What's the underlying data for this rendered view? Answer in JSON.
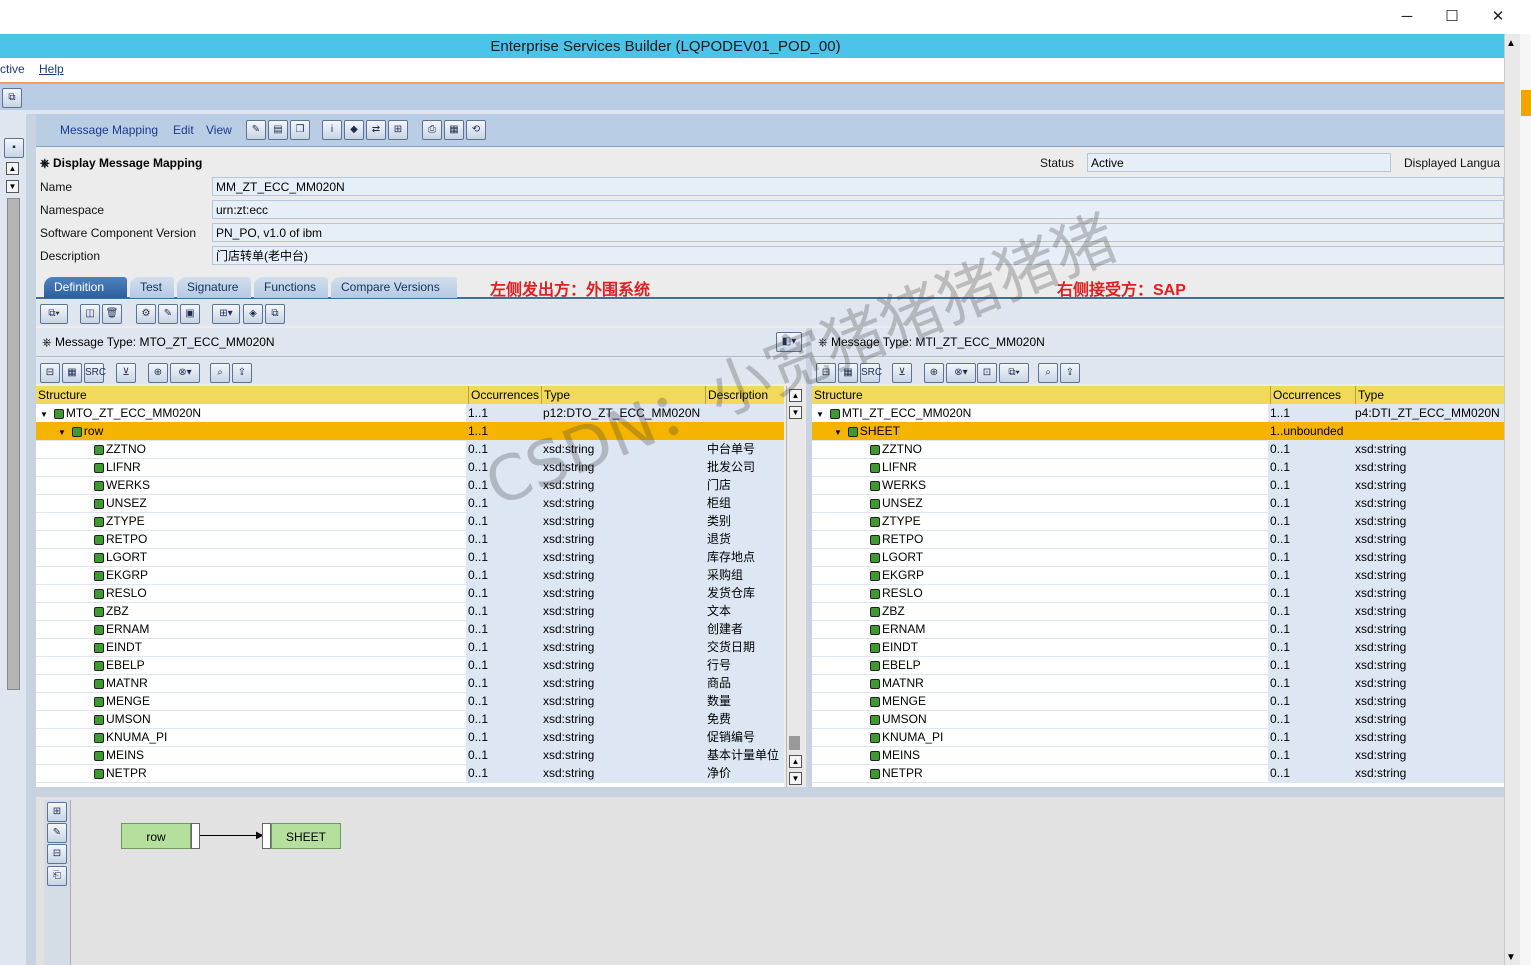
{
  "window": {
    "title": "Enterprise Services Builder (LQPODEV01_POD_00)",
    "minimize": "─",
    "maximize": "☐",
    "close": "✕"
  },
  "menubar": {
    "items": [
      "ctive",
      "Help"
    ]
  },
  "editor_menu": {
    "items": [
      "Message Mapping",
      "Edit",
      "View"
    ]
  },
  "form": {
    "heading": "Display Message Mapping",
    "status_label": "Status",
    "status_value": "Active",
    "displayed_lang_label": "Displayed Langua",
    "fields": [
      {
        "label": "Name",
        "value": "MM_ZT_ECC_MM020N"
      },
      {
        "label": "Namespace",
        "value": "urn:zt:ecc"
      },
      {
        "label": "Software Component Version",
        "value": "PN_PO, v1.0 of ibm"
      },
      {
        "label": "Description",
        "value": "门店转单(老中台)"
      }
    ]
  },
  "tabs": [
    "Definition",
    "Test",
    "Signature",
    "Functions",
    "Compare Versions"
  ],
  "annotations": {
    "left": "左侧发出方：外围系统",
    "right": "右侧接受方：SAP"
  },
  "watermark": "CSDN：小宽猪猪猪猪猪",
  "source": {
    "title": "Message Type: MTO_ZT_ECC_MM020N",
    "columns": [
      "Structure",
      "Occurrences",
      "Type",
      "Description"
    ],
    "root": {
      "name": "MTO_ZT_ECC_MM020N",
      "occ": "1..1",
      "type": "p12:DTO_ZT_ECC_MM020N",
      "desc": ""
    },
    "row": {
      "name": "row",
      "occ": "1..1",
      "type": "",
      "desc": ""
    },
    "fields": [
      {
        "name": "ZZTNO",
        "occ": "0..1",
        "type": "xsd:string",
        "desc": "中台单号"
      },
      {
        "name": "LIFNR",
        "occ": "0..1",
        "type": "xsd:string",
        "desc": "批发公司"
      },
      {
        "name": "WERKS",
        "occ": "0..1",
        "type": "xsd:string",
        "desc": "门店"
      },
      {
        "name": "UNSEZ",
        "occ": "0..1",
        "type": "xsd:string",
        "desc": "柜组"
      },
      {
        "name": "ZTYPE",
        "occ": "0..1",
        "type": "xsd:string",
        "desc": "类别"
      },
      {
        "name": "RETPO",
        "occ": "0..1",
        "type": "xsd:string",
        "desc": "退货"
      },
      {
        "name": "LGORT",
        "occ": "0..1",
        "type": "xsd:string",
        "desc": "库存地点"
      },
      {
        "name": "EKGRP",
        "occ": "0..1",
        "type": "xsd:string",
        "desc": "采购组"
      },
      {
        "name": "RESLO",
        "occ": "0..1",
        "type": "xsd:string",
        "desc": "发货仓库"
      },
      {
        "name": "ZBZ",
        "occ": "0..1",
        "type": "xsd:string",
        "desc": "文本"
      },
      {
        "name": "ERNAM",
        "occ": "0..1",
        "type": "xsd:string",
        "desc": "创建者"
      },
      {
        "name": "EINDT",
        "occ": "0..1",
        "type": "xsd:string",
        "desc": "交货日期"
      },
      {
        "name": "EBELP",
        "occ": "0..1",
        "type": "xsd:string",
        "desc": "行号"
      },
      {
        "name": "MATNR",
        "occ": "0..1",
        "type": "xsd:string",
        "desc": "商品"
      },
      {
        "name": "MENGE",
        "occ": "0..1",
        "type": "xsd:string",
        "desc": "数量"
      },
      {
        "name": "UMSON",
        "occ": "0..1",
        "type": "xsd:string",
        "desc": "免费"
      },
      {
        "name": "KNUMA_PI",
        "occ": "0..1",
        "type": "xsd:string",
        "desc": "促销编号"
      },
      {
        "name": "MEINS",
        "occ": "0..1",
        "type": "xsd:string",
        "desc": "基本计量单位"
      },
      {
        "name": "NETPR",
        "occ": "0..1",
        "type": "xsd:string",
        "desc": "净价"
      }
    ]
  },
  "target": {
    "title": "Message Type: MTI_ZT_ECC_MM020N",
    "columns": [
      "Structure",
      "Occurrences",
      "Type"
    ],
    "root": {
      "name": "MTI_ZT_ECC_MM020N",
      "occ": "1..1",
      "type": "p4:DTI_ZT_ECC_MM020N"
    },
    "row": {
      "name": "SHEET",
      "occ": "1..unbounded",
      "type": ""
    },
    "fields": [
      {
        "name": "ZZTNO",
        "occ": "0..1",
        "type": "xsd:string"
      },
      {
        "name": "LIFNR",
        "occ": "0..1",
        "type": "xsd:string"
      },
      {
        "name": "WERKS",
        "occ": "0..1",
        "type": "xsd:string"
      },
      {
        "name": "UNSEZ",
        "occ": "0..1",
        "type": "xsd:string"
      },
      {
        "name": "ZTYPE",
        "occ": "0..1",
        "type": "xsd:string"
      },
      {
        "name": "RETPO",
        "occ": "0..1",
        "type": "xsd:string"
      },
      {
        "name": "LGORT",
        "occ": "0..1",
        "type": "xsd:string"
      },
      {
        "name": "EKGRP",
        "occ": "0..1",
        "type": "xsd:string"
      },
      {
        "name": "RESLO",
        "occ": "0..1",
        "type": "xsd:string"
      },
      {
        "name": "ZBZ",
        "occ": "0..1",
        "type": "xsd:string"
      },
      {
        "name": "ERNAM",
        "occ": "0..1",
        "type": "xsd:string"
      },
      {
        "name": "EINDT",
        "occ": "0..1",
        "type": "xsd:string"
      },
      {
        "name": "EBELP",
        "occ": "0..1",
        "type": "xsd:string"
      },
      {
        "name": "MATNR",
        "occ": "0..1",
        "type": "xsd:string"
      },
      {
        "name": "MENGE",
        "occ": "0..1",
        "type": "xsd:string"
      },
      {
        "name": "UMSON",
        "occ": "0..1",
        "type": "xsd:string"
      },
      {
        "name": "KNUMA_PI",
        "occ": "0..1",
        "type": "xsd:string"
      },
      {
        "name": "MEINS",
        "occ": "0..1",
        "type": "xsd:string"
      },
      {
        "name": "NETPR",
        "occ": "0..1",
        "type": "xsd:string"
      }
    ]
  },
  "mapping": {
    "source_box": "row",
    "target_box": "SHEET"
  }
}
